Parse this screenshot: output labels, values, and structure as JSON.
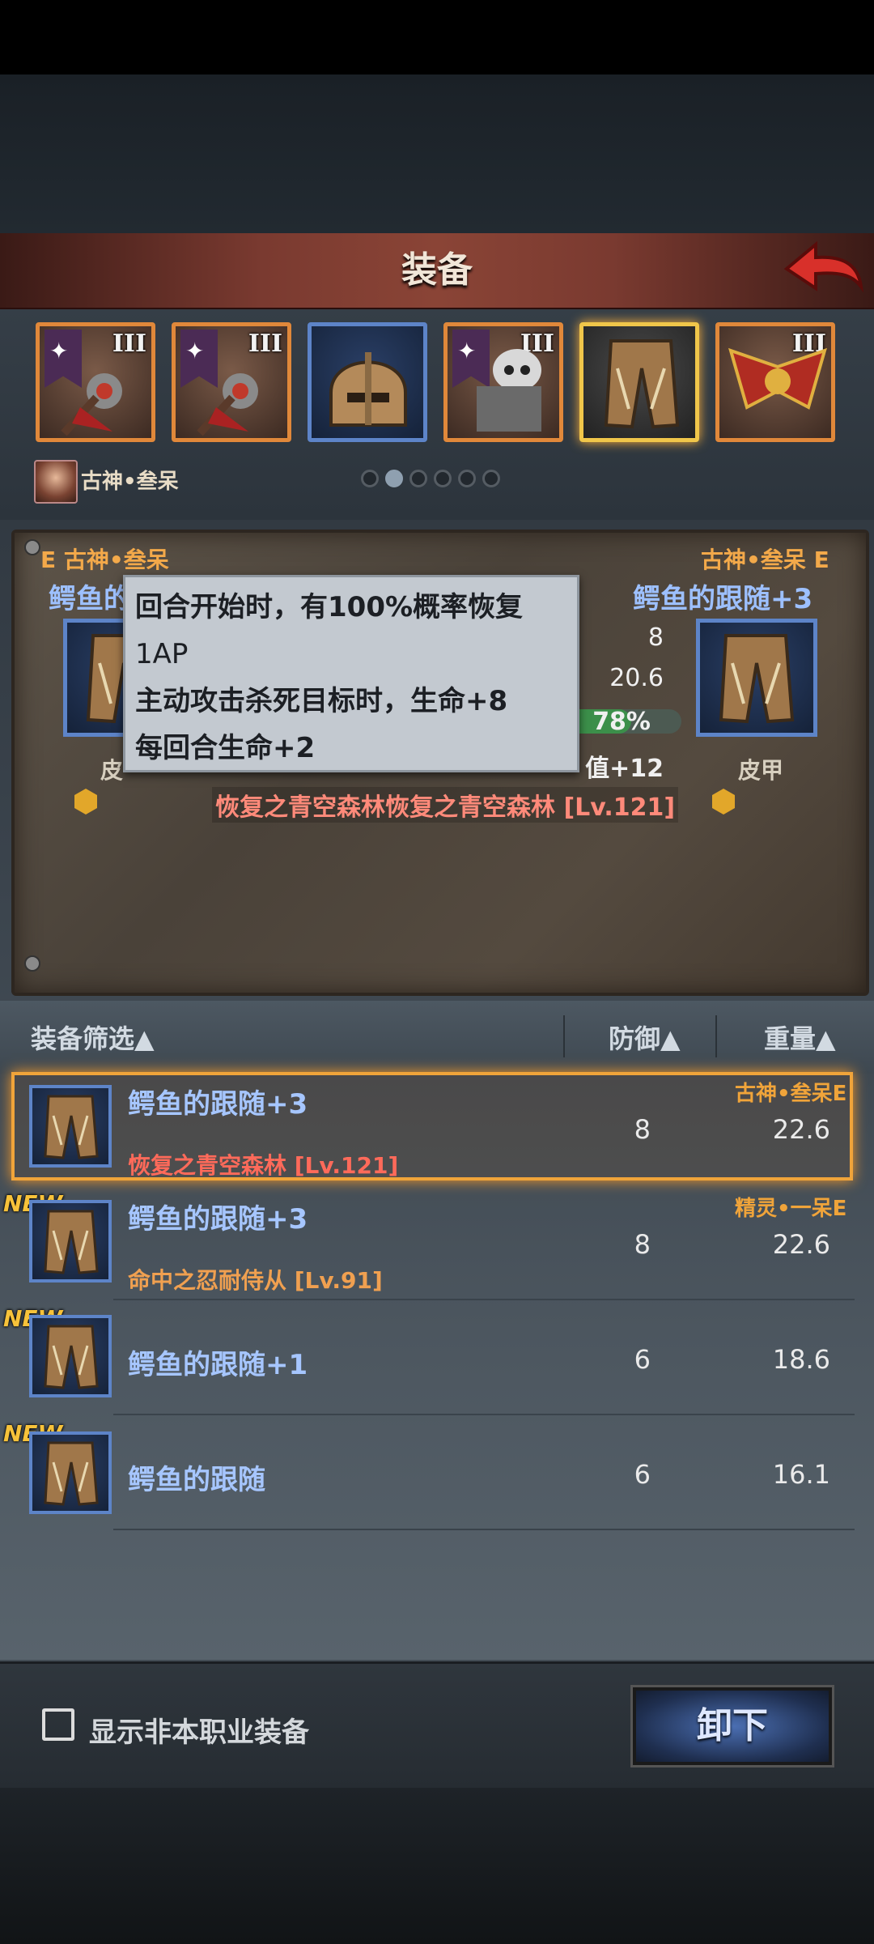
{
  "header": {
    "title": "装备"
  },
  "slots": [
    {
      "rank": "III",
      "banner": true
    },
    {
      "rank": "III",
      "banner": true
    },
    {
      "rank": ""
    },
    {
      "rank": "III",
      "banner": true
    },
    {
      "rank": ""
    },
    {
      "rank": "III"
    }
  ],
  "hero": {
    "name": "古神•叁呆"
  },
  "pager": {
    "count": 6,
    "active_index": 1
  },
  "compare": {
    "left_tag": "E 古神•叁呆",
    "right_tag": "古神•叁呆 E",
    "left_name": "鳄鱼的",
    "right_name": "鳄鱼的跟随+3",
    "left_type": "皮",
    "right_type": "皮甲",
    "stat_defense": "8",
    "stat_weight": "20.6",
    "stat_percent": "78%",
    "stat_bonus": "值+12",
    "set_line": "恢复之青空森林恢复之青空森林 [Lv.121]"
  },
  "tooltip": {
    "line1": "回合开始时，有100%概率恢复",
    "line2": "1AP",
    "line3": "主动攻击杀死目标时，生命+8",
    "line4": "每回合生命+2"
  },
  "list_header": {
    "filter": "装备筛选▲",
    "defense": "防御▲",
    "weight": "重量▲"
  },
  "items": [
    {
      "name": "鳄鱼的跟随+3",
      "set": "恢复之青空森林 [Lv.121]",
      "set_color": "#ff6a5a",
      "owner": "古神•叁呆E",
      "defense": "8",
      "weight": "22.6",
      "new": "",
      "selected": true
    },
    {
      "name": "鳄鱼的跟随+3",
      "set": "命中之忍耐侍从 [Lv.91]",
      "set_color": "#f0a050",
      "owner": "精灵•一呆E",
      "defense": "8",
      "weight": "22.6",
      "new": "NEW",
      "selected": false
    },
    {
      "name": "鳄鱼的跟随+1",
      "set": "",
      "set_color": "",
      "owner": "",
      "defense": "6",
      "weight": "18.6",
      "new": "NEW",
      "selected": false
    },
    {
      "name": "鳄鱼的跟随",
      "set": "",
      "set_color": "",
      "owner": "",
      "defense": "6",
      "weight": "16.1",
      "new": "NEW",
      "selected": false
    }
  ],
  "footer": {
    "checkbox_label": "显示非本职业装备",
    "unequip_label": "卸下"
  },
  "colors": {
    "accent_orange": "#f0a43a",
    "item_blue": "#a6c6ff",
    "set_red": "#ff6a5a"
  }
}
